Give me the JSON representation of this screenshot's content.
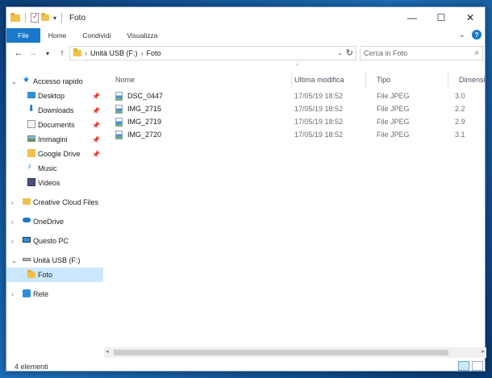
{
  "window": {
    "title": "Foto"
  },
  "ribbon": {
    "tabs": [
      {
        "label": "File"
      },
      {
        "label": "Home"
      },
      {
        "label": "Condividi"
      },
      {
        "label": "Visualizza"
      }
    ]
  },
  "address": {
    "crumbs": [
      "Unità USB (F:)",
      "Foto"
    ],
    "search_placeholder": "Cerca in Foto"
  },
  "sidebar": {
    "quick_access": "Accesso rapido",
    "quick_items": [
      {
        "label": "Desktop",
        "icon": "desktop-icon"
      },
      {
        "label": "Downloads",
        "icon": "download-icon"
      },
      {
        "label": "Documents",
        "icon": "documents-icon"
      },
      {
        "label": "Immagini",
        "icon": "pictures-icon"
      },
      {
        "label": "Google Drive",
        "icon": "google-drive-icon"
      },
      {
        "label": "Music",
        "icon": "music-icon"
      },
      {
        "label": "Videos",
        "icon": "videos-icon"
      }
    ],
    "creative_cloud": "Creative Cloud Files",
    "onedrive": "OneDrive",
    "this_pc": "Questo PC",
    "usb_drive": "Unità USB (F:)",
    "foto": "Foto",
    "network": "Rete"
  },
  "columns": {
    "name": "Nome",
    "modified": "Ultima modifica",
    "type": "Tipo",
    "size": "Dimensione"
  },
  "files": [
    {
      "name": "DSC_0447",
      "modified": "17/05/19 18:52",
      "type": "File JPEG",
      "size": "3.0"
    },
    {
      "name": "IMG_2715",
      "modified": "17/05/19 18:52",
      "type": "File JPEG",
      "size": "2.2"
    },
    {
      "name": "IMG_2719",
      "modified": "17/05/19 18:52",
      "type": "File JPEG",
      "size": "2.9"
    },
    {
      "name": "IMG_2720",
      "modified": "17/05/19 18:52",
      "type": "File JPEG",
      "size": "3.1"
    }
  ],
  "status": {
    "count": "4 elementi"
  },
  "colors": {
    "accent": "#1979ca",
    "selected": "#cce8ff",
    "folder": "#f1c24b"
  }
}
